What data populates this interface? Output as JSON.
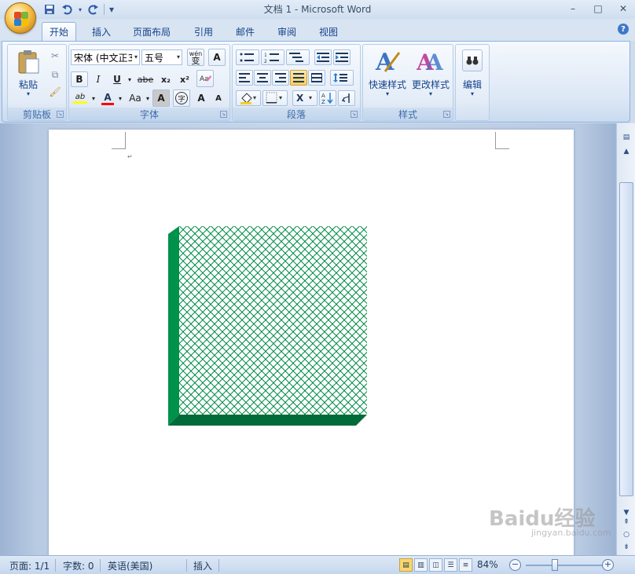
{
  "window": {
    "title": "文档 1 - Microsoft Word",
    "controls": [
      "–",
      "□",
      "✕"
    ]
  },
  "qat": {
    "save": "save-icon",
    "undo": "undo-icon",
    "redo": "redo-icon",
    "customize": "▾"
  },
  "tabs": [
    {
      "label": "开始",
      "active": true
    },
    {
      "label": "插入"
    },
    {
      "label": "页面布局"
    },
    {
      "label": "引用"
    },
    {
      "label": "邮件"
    },
    {
      "label": "审阅"
    },
    {
      "label": "视图"
    }
  ],
  "ribbon": {
    "clipboard": {
      "label": "剪贴板",
      "paste": "粘贴"
    },
    "font": {
      "label": "字体",
      "font_name": "宋体 (中文正3",
      "font_size": "五号",
      "pinyin": "wén\n变",
      "border_char": "A",
      "bold": "B",
      "italic": "I",
      "underline": "U",
      "strike": "abe",
      "subscript": "x₂",
      "superscript": "x²",
      "case": "Aa",
      "shade_char": "A",
      "enclose_char": "字",
      "grow": "A",
      "shrink": "A"
    },
    "paragraph": {
      "label": "段落"
    },
    "styles": {
      "label": "样式",
      "quick_styles": "快速样式",
      "change_styles": "更改样式"
    },
    "editing": {
      "label": "编辑"
    }
  },
  "document": {
    "paragraph_mark": "↵",
    "shape": {
      "face_color": "#00a050",
      "side_color": "#00914a",
      "bottom_color": "#006b38",
      "pattern": "green diagonal trellis"
    }
  },
  "status": {
    "page": "页面: 1/1",
    "words": "字数: 0",
    "language": "英语(美国)",
    "mode": "插入",
    "zoom": "84%",
    "zoom_level": 0.84
  },
  "watermark": {
    "text": "Baidu经验",
    "sub": "jingyan.baidu.com"
  },
  "colors": {
    "accent": "#15428b",
    "highlight": "#ffff00",
    "font_color": "#ff0000"
  }
}
